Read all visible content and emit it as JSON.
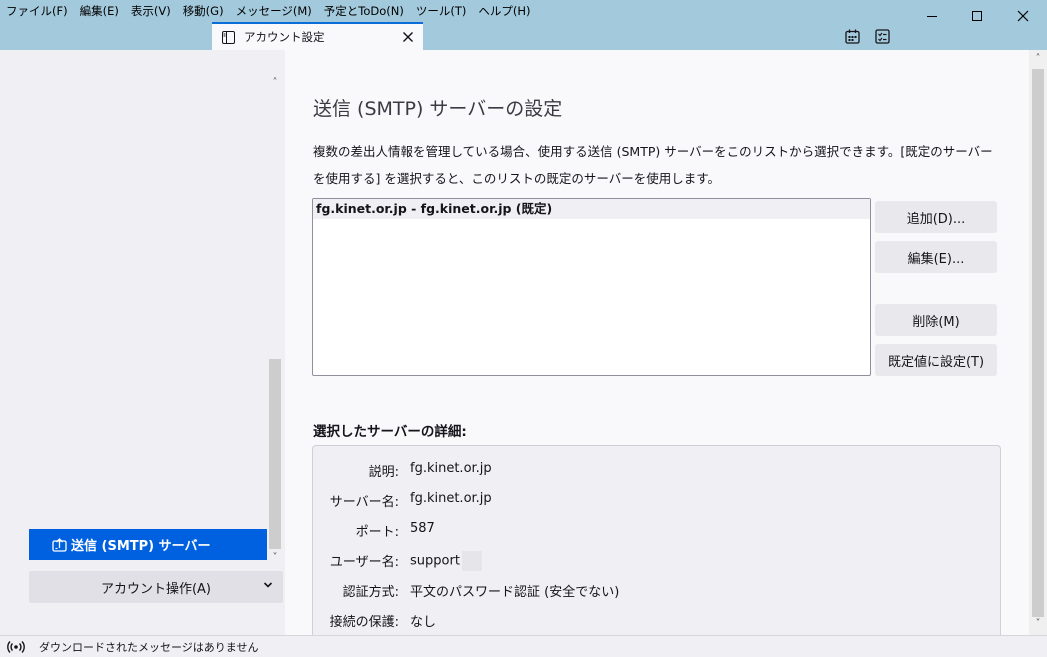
{
  "menu": {
    "items": [
      "ファイル(F)",
      "編集(E)",
      "表示(V)",
      "移動(G)",
      "メッセージ(M)",
      "予定とToDo(N)",
      "ツール(T)",
      "ヘルプ(H)"
    ]
  },
  "window_controls": {
    "minimize": "—",
    "maximize": "☐",
    "close": "✕"
  },
  "tab": {
    "label": "アカウント設定",
    "close": "✕"
  },
  "toolbar": {
    "calendar_icon": "calendar-icon",
    "tasks_icon": "tasks-icon"
  },
  "sidebar": {
    "selected_item": "送信 (SMTP) サーバー",
    "account_actions": "アカウント操作(A)",
    "scroll_up": "˄",
    "scroll_down": "˅",
    "chevron": "⌄"
  },
  "main": {
    "title": "送信 (SMTP) サーバーの設定",
    "description": "複数の差出人情報を管理している場合、使用する送信 (SMTP) サーバーをこのリストから選択できます。[既定のサーバーを使用する] を選択すると、このリストの既定のサーバーを使用します。",
    "server_list": [
      "fg.kinet.or.jp - fg.kinet.or.jp (既定)"
    ],
    "buttons": {
      "add": "追加(D)...",
      "edit": "編集(E)...",
      "delete": "削除(M)",
      "set_default": "既定値に設定(T)"
    },
    "details_heading": "選択したサーバーの詳細:",
    "details": [
      {
        "label": "説明:",
        "value": "fg.kinet.or.jp"
      },
      {
        "label": "サーバー名:",
        "value": "fg.kinet.or.jp"
      },
      {
        "label": "ポート:",
        "value": "587"
      },
      {
        "label": "ユーザー名:",
        "value": "support"
      },
      {
        "label": "認証方式:",
        "value": "平文のパスワード認証 (安全でない)"
      },
      {
        "label": "接続の保護:",
        "value": "なし"
      }
    ]
  },
  "statusbar": {
    "text": "ダウンロードされたメッセージはありません"
  },
  "colors": {
    "titlebar": "#a3c9dc",
    "accent": "#0061e0",
    "tab_border": "#0b6dd8"
  }
}
